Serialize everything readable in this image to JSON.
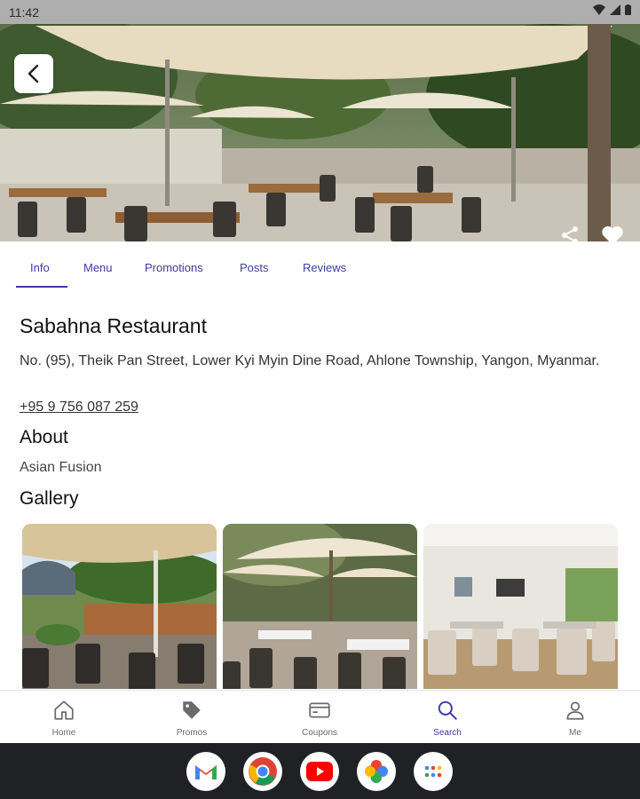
{
  "status_bar": {
    "time": "11:42"
  },
  "tabs": [
    {
      "label": "Info"
    },
    {
      "label": "Menu"
    },
    {
      "label": "Promotions"
    },
    {
      "label": "Posts"
    },
    {
      "label": "Reviews"
    }
  ],
  "restaurant": {
    "name": "Sabahna Restaurant",
    "address": "No. (95), Theik Pan Street, Lower Kyi Myin Dine Road, Ahlone Township, Yangon, Myanmar.",
    "phone": "+95 9 756 087 259"
  },
  "about": {
    "heading": "About",
    "text": "Asian Fusion"
  },
  "gallery": {
    "heading": "Gallery"
  },
  "bottom_nav": [
    {
      "label": "Home",
      "icon": "home-icon"
    },
    {
      "label": "Promos",
      "icon": "tag-icon"
    },
    {
      "label": "Coupons",
      "icon": "coupon-icon"
    },
    {
      "label": "Search",
      "icon": "search-icon",
      "active": true
    },
    {
      "label": "Me",
      "icon": "person-icon"
    }
  ],
  "dock_apps": [
    {
      "icon": "gmail-icon"
    },
    {
      "icon": "chrome-icon"
    },
    {
      "icon": "youtube-icon"
    },
    {
      "icon": "photos-icon"
    },
    {
      "icon": "app-drawer-icon"
    }
  ],
  "colors": {
    "accent": "#3f3aa8",
    "dock": "#202124",
    "status_bar": "#aeaeae"
  }
}
